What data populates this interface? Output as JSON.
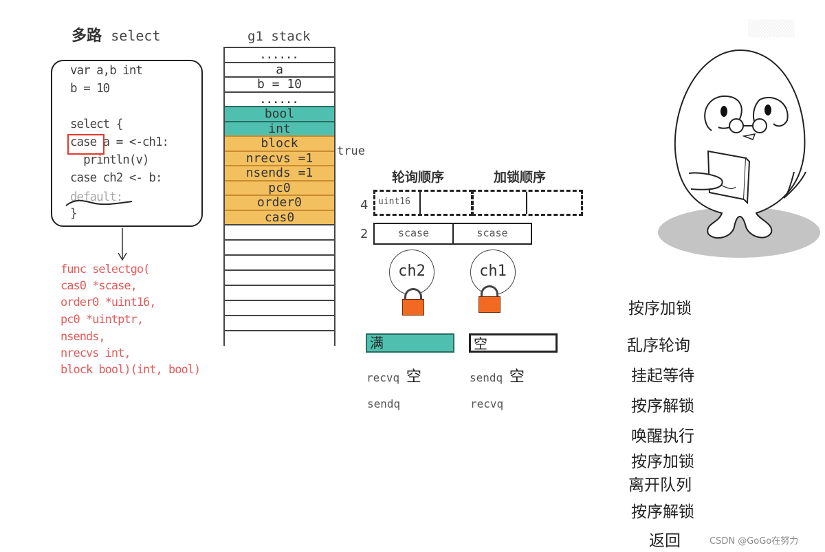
{
  "title": {
    "cn": "多路",
    "en": "select"
  },
  "code": {
    "lines": [
      "var a,b int",
      "b = 10",
      "",
      "select {",
      "case a = <-ch1:",
      "  println(v)",
      "case ch2 <- b:",
      "default:",
      "}"
    ],
    "highlight_word": "case",
    "struck_line": "default:"
  },
  "signature": {
    "lines": [
      "func selectgo(",
      "cas0 *scase,",
      "order0 *uint16,",
      "pc0 *uintptr,",
      "nsends,",
      "nrecvs int,",
      "block bool)(int, bool)"
    ]
  },
  "stack": {
    "title": "g1 stack",
    "rows": [
      {
        "label": "......",
        "kind": "white"
      },
      {
        "label": "a",
        "kind": "white"
      },
      {
        "label": "b = 10",
        "kind": "white"
      },
      {
        "label": "......",
        "kind": "white"
      },
      {
        "label": "bool",
        "kind": "teal"
      },
      {
        "label": "int",
        "kind": "teal"
      },
      {
        "label": "block",
        "kind": "orange"
      },
      {
        "label": "nrecvs =1",
        "kind": "orange"
      },
      {
        "label": "nsends =1",
        "kind": "orange"
      },
      {
        "label": "pc0",
        "kind": "orange"
      },
      {
        "label": "order0",
        "kind": "orange"
      },
      {
        "label": "cas0",
        "kind": "orange"
      }
    ],
    "block_value": "true",
    "empty_rows": 8
  },
  "order": {
    "poll_header": "轮询顺序",
    "lock_header": "加锁顺序",
    "order_index": "4",
    "order_cell_label": "uint16",
    "scase_index": "2",
    "scase_cells": [
      "scase",
      "scase"
    ]
  },
  "channels": [
    {
      "name": "ch2",
      "buffer": "满",
      "buffer_state": "full",
      "q1": "recvq",
      "q1_state": "空",
      "q2": "sendq"
    },
    {
      "name": "ch1",
      "buffer": "空",
      "buffer_state": "empty",
      "q1": "sendq",
      "q1_state": "空",
      "q2": "recvq"
    }
  ],
  "colors": {
    "teal": "#4fc0b0",
    "orange": "#f3c060",
    "lock": "#f26a22",
    "highlight": "#e03a2c",
    "signature": "#e25c5c"
  },
  "steps": [
    "按序加锁",
    "乱序轮询",
    "挂起等待",
    "按序解锁",
    "唤醒执行",
    "按序加锁",
    "离开队列",
    "按序解锁",
    "返回"
  ],
  "watermark": "CSDN @GoGo在努力"
}
